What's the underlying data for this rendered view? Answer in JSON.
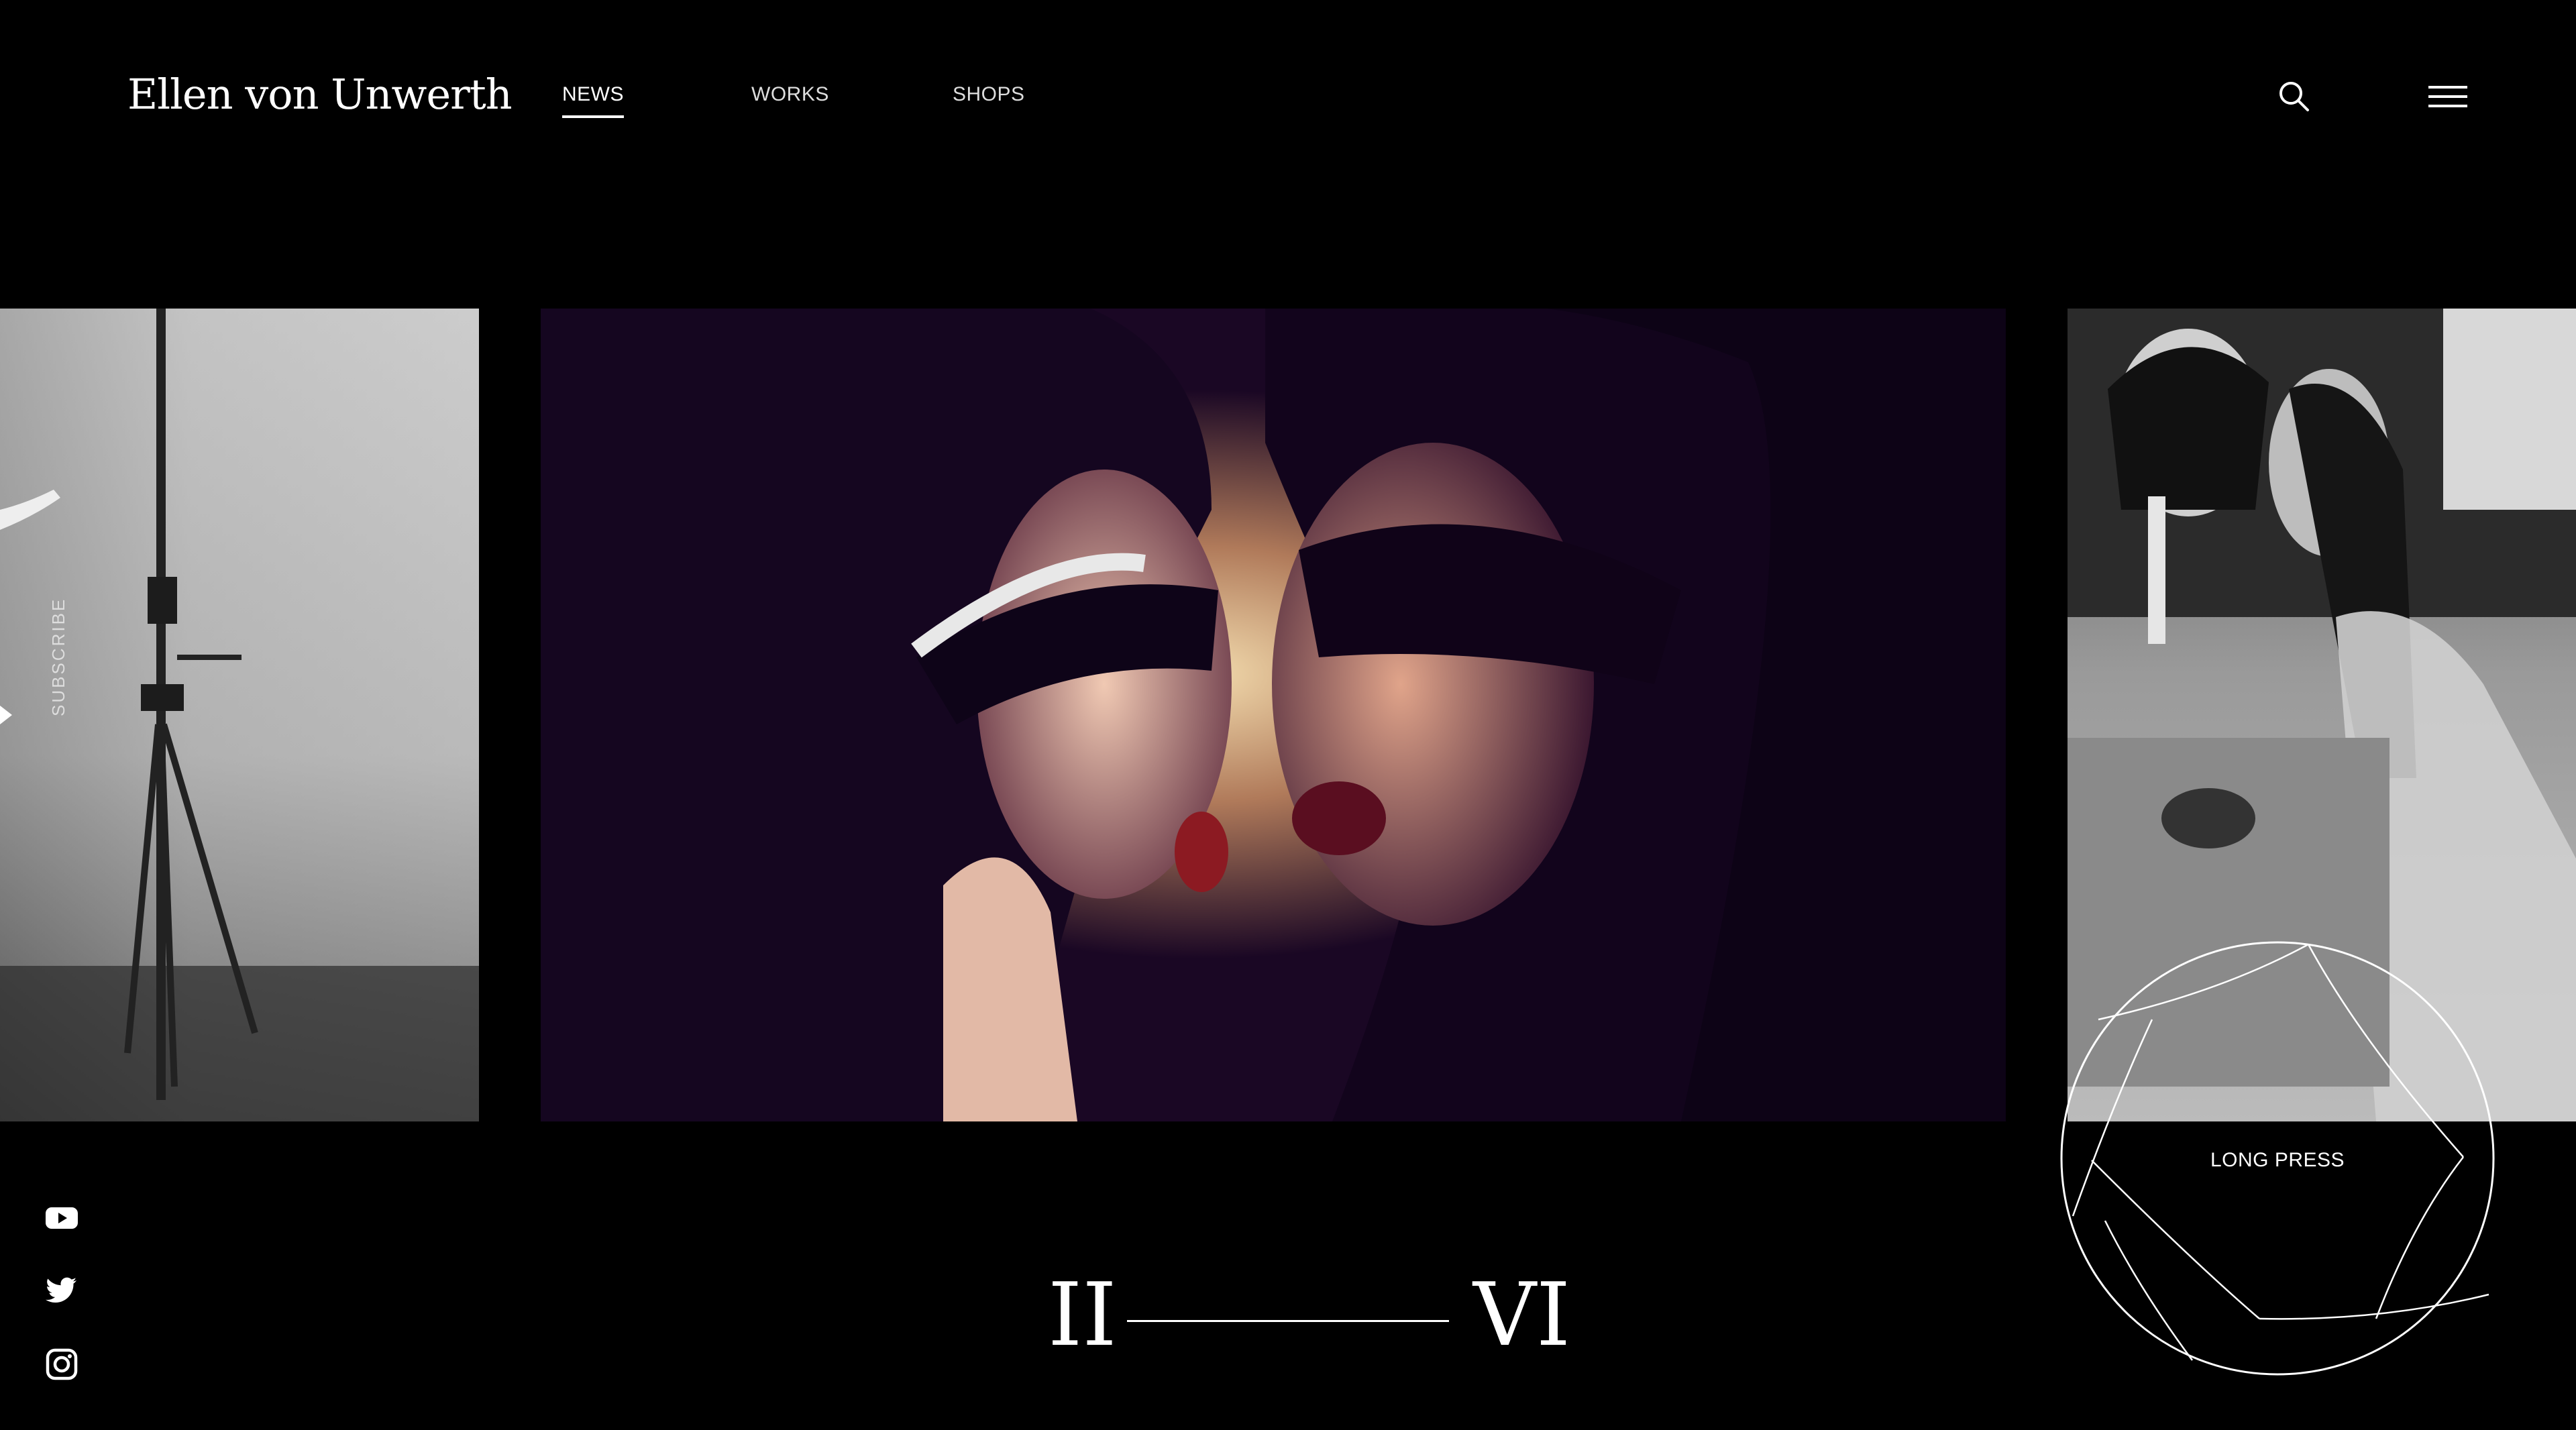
{
  "brand": {
    "name": "Ellen von Unwerth"
  },
  "nav": {
    "items": [
      {
        "label": "NEWS",
        "active": true
      },
      {
        "label": "WORKS",
        "active": false
      },
      {
        "label": "SHOPS",
        "active": false
      }
    ]
  },
  "header_icons": {
    "search": "search-icon",
    "menu": "hamburger-menu-icon"
  },
  "sidebar": {
    "subscribe_label": "SUBSCRIBE",
    "social": [
      "youtube-icon",
      "twitter-icon",
      "instagram-icon"
    ]
  },
  "gallery": {
    "slides": [
      {
        "role": "previous",
        "tone": "grayscale"
      },
      {
        "role": "current",
        "tone": "color"
      },
      {
        "role": "next",
        "tone": "grayscale"
      }
    ]
  },
  "pager": {
    "current": "II",
    "total": "VI"
  },
  "long_press": {
    "label": "LONG PRESS"
  },
  "colors": {
    "background": "#000000",
    "text": "#ffffff",
    "accent": "#ffffff"
  }
}
